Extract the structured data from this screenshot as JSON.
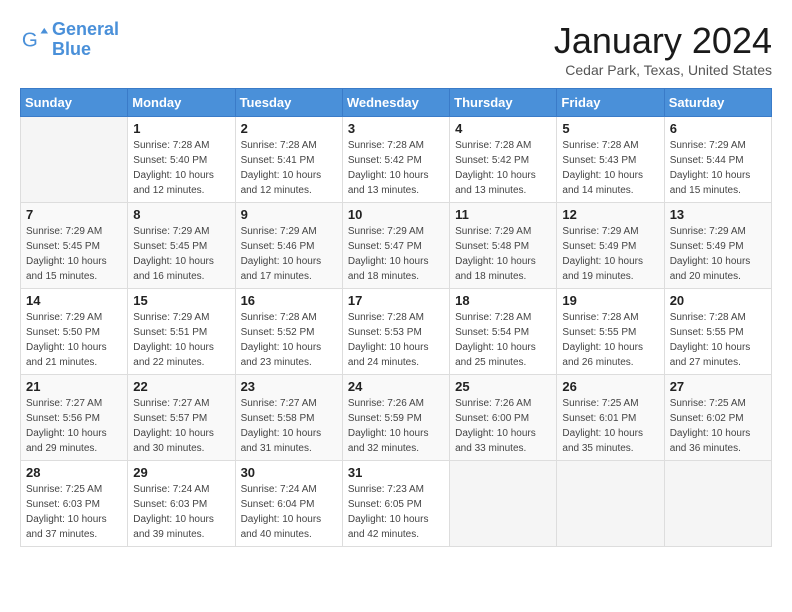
{
  "header": {
    "logo_line1": "General",
    "logo_line2": "Blue",
    "month_title": "January 2024",
    "location": "Cedar Park, Texas, United States"
  },
  "weekdays": [
    "Sunday",
    "Monday",
    "Tuesday",
    "Wednesday",
    "Thursday",
    "Friday",
    "Saturday"
  ],
  "weeks": [
    [
      {
        "num": "",
        "empty": true
      },
      {
        "num": "1",
        "sunrise": "7:28 AM",
        "sunset": "5:40 PM",
        "daylight": "10 hours and 12 minutes."
      },
      {
        "num": "2",
        "sunrise": "7:28 AM",
        "sunset": "5:41 PM",
        "daylight": "10 hours and 12 minutes."
      },
      {
        "num": "3",
        "sunrise": "7:28 AM",
        "sunset": "5:42 PM",
        "daylight": "10 hours and 13 minutes."
      },
      {
        "num": "4",
        "sunrise": "7:28 AM",
        "sunset": "5:42 PM",
        "daylight": "10 hours and 13 minutes."
      },
      {
        "num": "5",
        "sunrise": "7:28 AM",
        "sunset": "5:43 PM",
        "daylight": "10 hours and 14 minutes."
      },
      {
        "num": "6",
        "sunrise": "7:29 AM",
        "sunset": "5:44 PM",
        "daylight": "10 hours and 15 minutes."
      }
    ],
    [
      {
        "num": "7",
        "sunrise": "7:29 AM",
        "sunset": "5:45 PM",
        "daylight": "10 hours and 15 minutes."
      },
      {
        "num": "8",
        "sunrise": "7:29 AM",
        "sunset": "5:45 PM",
        "daylight": "10 hours and 16 minutes."
      },
      {
        "num": "9",
        "sunrise": "7:29 AM",
        "sunset": "5:46 PM",
        "daylight": "10 hours and 17 minutes."
      },
      {
        "num": "10",
        "sunrise": "7:29 AM",
        "sunset": "5:47 PM",
        "daylight": "10 hours and 18 minutes."
      },
      {
        "num": "11",
        "sunrise": "7:29 AM",
        "sunset": "5:48 PM",
        "daylight": "10 hours and 18 minutes."
      },
      {
        "num": "12",
        "sunrise": "7:29 AM",
        "sunset": "5:49 PM",
        "daylight": "10 hours and 19 minutes."
      },
      {
        "num": "13",
        "sunrise": "7:29 AM",
        "sunset": "5:49 PM",
        "daylight": "10 hours and 20 minutes."
      }
    ],
    [
      {
        "num": "14",
        "sunrise": "7:29 AM",
        "sunset": "5:50 PM",
        "daylight": "10 hours and 21 minutes."
      },
      {
        "num": "15",
        "sunrise": "7:29 AM",
        "sunset": "5:51 PM",
        "daylight": "10 hours and 22 minutes."
      },
      {
        "num": "16",
        "sunrise": "7:28 AM",
        "sunset": "5:52 PM",
        "daylight": "10 hours and 23 minutes."
      },
      {
        "num": "17",
        "sunrise": "7:28 AM",
        "sunset": "5:53 PM",
        "daylight": "10 hours and 24 minutes."
      },
      {
        "num": "18",
        "sunrise": "7:28 AM",
        "sunset": "5:54 PM",
        "daylight": "10 hours and 25 minutes."
      },
      {
        "num": "19",
        "sunrise": "7:28 AM",
        "sunset": "5:55 PM",
        "daylight": "10 hours and 26 minutes."
      },
      {
        "num": "20",
        "sunrise": "7:28 AM",
        "sunset": "5:55 PM",
        "daylight": "10 hours and 27 minutes."
      }
    ],
    [
      {
        "num": "21",
        "sunrise": "7:27 AM",
        "sunset": "5:56 PM",
        "daylight": "10 hours and 29 minutes."
      },
      {
        "num": "22",
        "sunrise": "7:27 AM",
        "sunset": "5:57 PM",
        "daylight": "10 hours and 30 minutes."
      },
      {
        "num": "23",
        "sunrise": "7:27 AM",
        "sunset": "5:58 PM",
        "daylight": "10 hours and 31 minutes."
      },
      {
        "num": "24",
        "sunrise": "7:26 AM",
        "sunset": "5:59 PM",
        "daylight": "10 hours and 32 minutes."
      },
      {
        "num": "25",
        "sunrise": "7:26 AM",
        "sunset": "6:00 PM",
        "daylight": "10 hours and 33 minutes."
      },
      {
        "num": "26",
        "sunrise": "7:25 AM",
        "sunset": "6:01 PM",
        "daylight": "10 hours and 35 minutes."
      },
      {
        "num": "27",
        "sunrise": "7:25 AM",
        "sunset": "6:02 PM",
        "daylight": "10 hours and 36 minutes."
      }
    ],
    [
      {
        "num": "28",
        "sunrise": "7:25 AM",
        "sunset": "6:03 PM",
        "daylight": "10 hours and 37 minutes."
      },
      {
        "num": "29",
        "sunrise": "7:24 AM",
        "sunset": "6:03 PM",
        "daylight": "10 hours and 39 minutes."
      },
      {
        "num": "30",
        "sunrise": "7:24 AM",
        "sunset": "6:04 PM",
        "daylight": "10 hours and 40 minutes."
      },
      {
        "num": "31",
        "sunrise": "7:23 AM",
        "sunset": "6:05 PM",
        "daylight": "10 hours and 42 minutes."
      },
      {
        "num": "",
        "empty": true
      },
      {
        "num": "",
        "empty": true
      },
      {
        "num": "",
        "empty": true
      }
    ]
  ]
}
